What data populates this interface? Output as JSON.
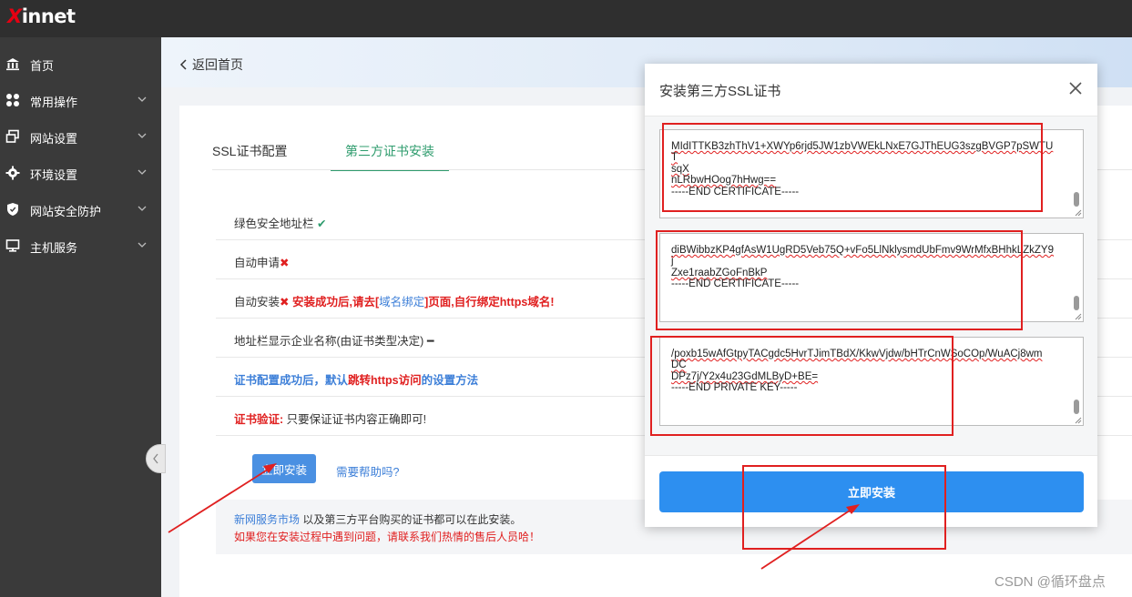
{
  "brand": {
    "logo_x": "X",
    "logo_rest": "innet"
  },
  "sidebar": {
    "items": [
      {
        "label": "首页",
        "icon": "bank-icon",
        "has_chevron": false
      },
      {
        "label": "常用操作",
        "icon": "grid-icon",
        "has_chevron": true
      },
      {
        "label": "网站设置",
        "icon": "windows-icon",
        "has_chevron": true
      },
      {
        "label": "环境设置",
        "icon": "gear-icon",
        "has_chevron": true
      },
      {
        "label": "网站安全防护",
        "icon": "shield-icon",
        "has_chevron": true
      },
      {
        "label": "主机服务",
        "icon": "monitor-icon",
        "has_chevron": true
      }
    ]
  },
  "header": {
    "back_label": "返回首页"
  },
  "tabs": [
    {
      "label": "SSL证书配置",
      "active": false
    },
    {
      "label": "第三方证书安装",
      "active": true
    }
  ],
  "rows": {
    "r1": {
      "label": "绿色安全地址栏",
      "mark": "✔"
    },
    "r2": {
      "label": "自动申请",
      "mark": "✖"
    },
    "r3": {
      "label": "自动安装",
      "mark": "✖",
      "note_a": "安装成功后,请去[",
      "note_link": "域名绑定",
      "note_b": "]页面,自行绑定https域名!"
    },
    "r4": {
      "label": "地址栏显示企业名称(由证书类型决定)",
      "mark": "━"
    },
    "r5": {
      "a": "证书配置成功后，默认",
      "b": "跳转https访问",
      "c": "的设置方法"
    },
    "r6": {
      "a": "证书验证:",
      "b": " 只要保证证书内容正确即可!"
    }
  },
  "actions": {
    "install_label": "立即安装",
    "help_label": "需要帮助吗?"
  },
  "notice": {
    "link": "新网服务市场",
    "text": " 以及第三方平台购买的证书都可以在此安装。",
    "warning": "如果您在安装过程中遇到问题，请联系我们热情的售后人员哈！"
  },
  "modal": {
    "title": "安装第三方SSL证书",
    "box1": {
      "lines": [
        "MIdITTKB3zhThV1+XWYp6rjd5JW1zbVWEkLNxE7GJThEUG3szgBVGP7pSWTUT",
        "sqX",
        "nLRbwHOog7hHwg==",
        "-----END CERTIFICATE-----"
      ]
    },
    "box2": {
      "lines": [
        "diBWibbzKP4gfAsW1UgRD5Veb75Q+vFo5LlNklysmdUbFmv9WrMfxBHhkLZkZY9",
        "j",
        "Zxe1raabZGoFnBkP",
        "-----END CERTIFICATE-----"
      ]
    },
    "box3": {
      "lines": [
        "/poxb15wAfGtpyTACgdc5HvrTJimTBdX/KkwVjdw/bHTrCnWSoCOp/WuACj8wm",
        "DC",
        "DPz7j/Y2x4u23GdMLByD+BE=",
        "-----END PRIVATE KEY-----"
      ]
    },
    "install_label": "立即安装"
  },
  "colors": {
    "accent_green": "#2f9c6e",
    "primary_blue": "#2d8ff0",
    "annotation_red": "#e02020"
  },
  "watermark": "CSDN @循环盘点"
}
